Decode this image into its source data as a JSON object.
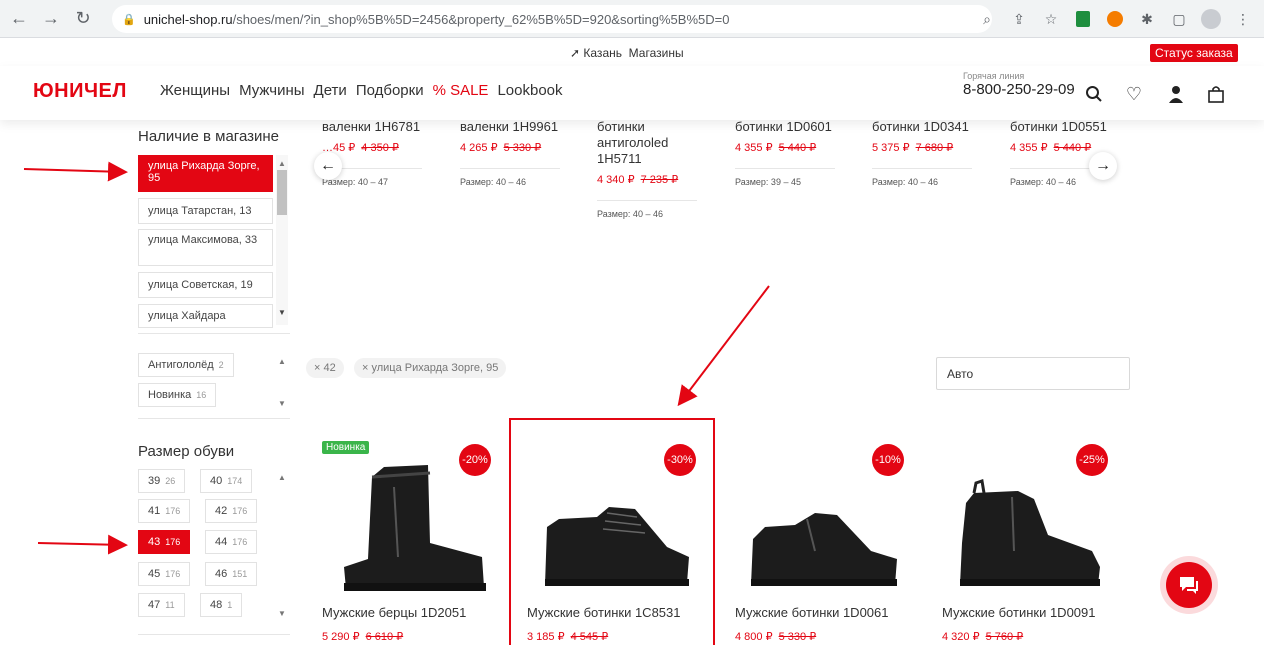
{
  "browser": {
    "url_host": "unichel-shop.ru",
    "url_path": "/shoes/men/?in_shop%5B%5D=2456&property_62%5B%5D=920&sorting%5B%5D=0"
  },
  "topbar": {
    "city": "Казань",
    "stores": "Магазины",
    "order_status": "Статус заказа"
  },
  "header": {
    "logo": "ЮНИЧЕЛ",
    "menu": [
      "Женщины",
      "Мужчины",
      "Дети",
      "Подборки",
      "% SALE",
      "Lookbook"
    ],
    "hotline_caption": "Горячая линия",
    "hotline_phone": "8-800-250-29-09"
  },
  "sidebar": {
    "store_title": "Наличие в магазине",
    "stores": [
      {
        "label": "улица Рихарда Зорге, 95",
        "active": true
      },
      {
        "label": "улица Татарстан, 13"
      },
      {
        "label": "улица Максимова, 33"
      },
      {
        "label": "улица Советская, 19"
      },
      {
        "label": "улица Хайдара"
      }
    ],
    "tags": [
      {
        "label": "Антигололёд",
        "count": "2"
      },
      {
        "label": "Новинка",
        "count": "16"
      }
    ],
    "size_title": "Размер обуви",
    "sizes": [
      {
        "label": "39",
        "count": "26"
      },
      {
        "label": "40",
        "count": "174"
      },
      {
        "label": "41",
        "count": "176"
      },
      {
        "label": "42",
        "count": "176"
      },
      {
        "label": "43",
        "count": "176",
        "active": true
      },
      {
        "label": "44",
        "count": "176"
      },
      {
        "label": "45",
        "count": "176"
      },
      {
        "label": "46",
        "count": "151"
      },
      {
        "label": "47",
        "count": "11"
      },
      {
        "label": "48",
        "count": "1"
      }
    ]
  },
  "carousel": [
    {
      "name": "валенки 1Н6781",
      "price": "…45 ₽",
      "old": "4 350 ₽",
      "size": "Размер: 40 – 47"
    },
    {
      "name": "валенки 1Н9961",
      "price": "4 265 ₽",
      "old": "5 330 ₽",
      "size": "Размер: 40 – 46"
    },
    {
      "name": "ботинки антиголоled 1Н5711",
      "price": "4 340 ₽",
      "old": "7 235 ₽",
      "size": "Размер: 40 – 46"
    },
    {
      "name": "ботинки 1D0601",
      "price": "4 355 ₽",
      "old": "5 440 ₽",
      "size": "Размер: 39 – 45"
    },
    {
      "name": "ботинки 1D0341",
      "price": "5 375 ₽",
      "old": "7 680 ₽",
      "size": "Размер: 40 – 46"
    },
    {
      "name": "ботинки 1D0551",
      "price": "4 355 ₽",
      "old": "5 440 ₽",
      "size": "Размер: 40 – 46"
    }
  ],
  "filters": {
    "applied": [
      "× 42",
      "× улица Рихарда Зорге, 95"
    ],
    "sort": "Авто"
  },
  "products": [
    {
      "name": "Мужские берцы 1D2051",
      "price": "5 290 ₽",
      "old": "6 610 ₽",
      "discount": "-20%",
      "badge": "Новинка"
    },
    {
      "name": "Мужские ботинки 1C8531",
      "price": "3 185 ₽",
      "old": "4 545 ₽",
      "discount": "-30%"
    },
    {
      "name": "Мужские ботинки 1D0061",
      "price": "4 800 ₽",
      "old": "5 330 ₽",
      "discount": "-10%"
    },
    {
      "name": "Мужские ботинки 1D0091",
      "price": "4 320 ₽",
      "old": "5 760 ₽",
      "discount": "-25%"
    }
  ],
  "colors": {
    "brand_red": "#e30613",
    "new_green": "#3ab54a"
  }
}
